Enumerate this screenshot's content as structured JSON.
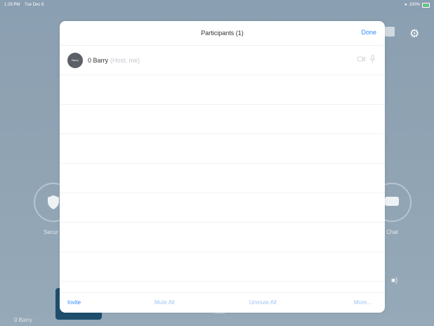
{
  "status": {
    "time": "1:29 PM",
    "date": "Tue Dec 8",
    "battery": "100%"
  },
  "background": {
    "security_label": "Secur",
    "chat_label": "Chat",
    "bottom_name": "0 Barry",
    "bottom_mid": "Leave"
  },
  "modal": {
    "title": "Participants (1)",
    "done_label": "Done",
    "participants": [
      {
        "avatar_text": "Barry",
        "name": "0 Barry",
        "role": "(Host, me)"
      }
    ],
    "footer": {
      "invite": "Invite",
      "mute_all": "Mute All",
      "unmute_all": "Unmute All",
      "more": "More..."
    }
  },
  "colors": {
    "accent": "#2d8cff",
    "disabled_accent": "#9cc3f5",
    "background": "#8ea2b3"
  }
}
